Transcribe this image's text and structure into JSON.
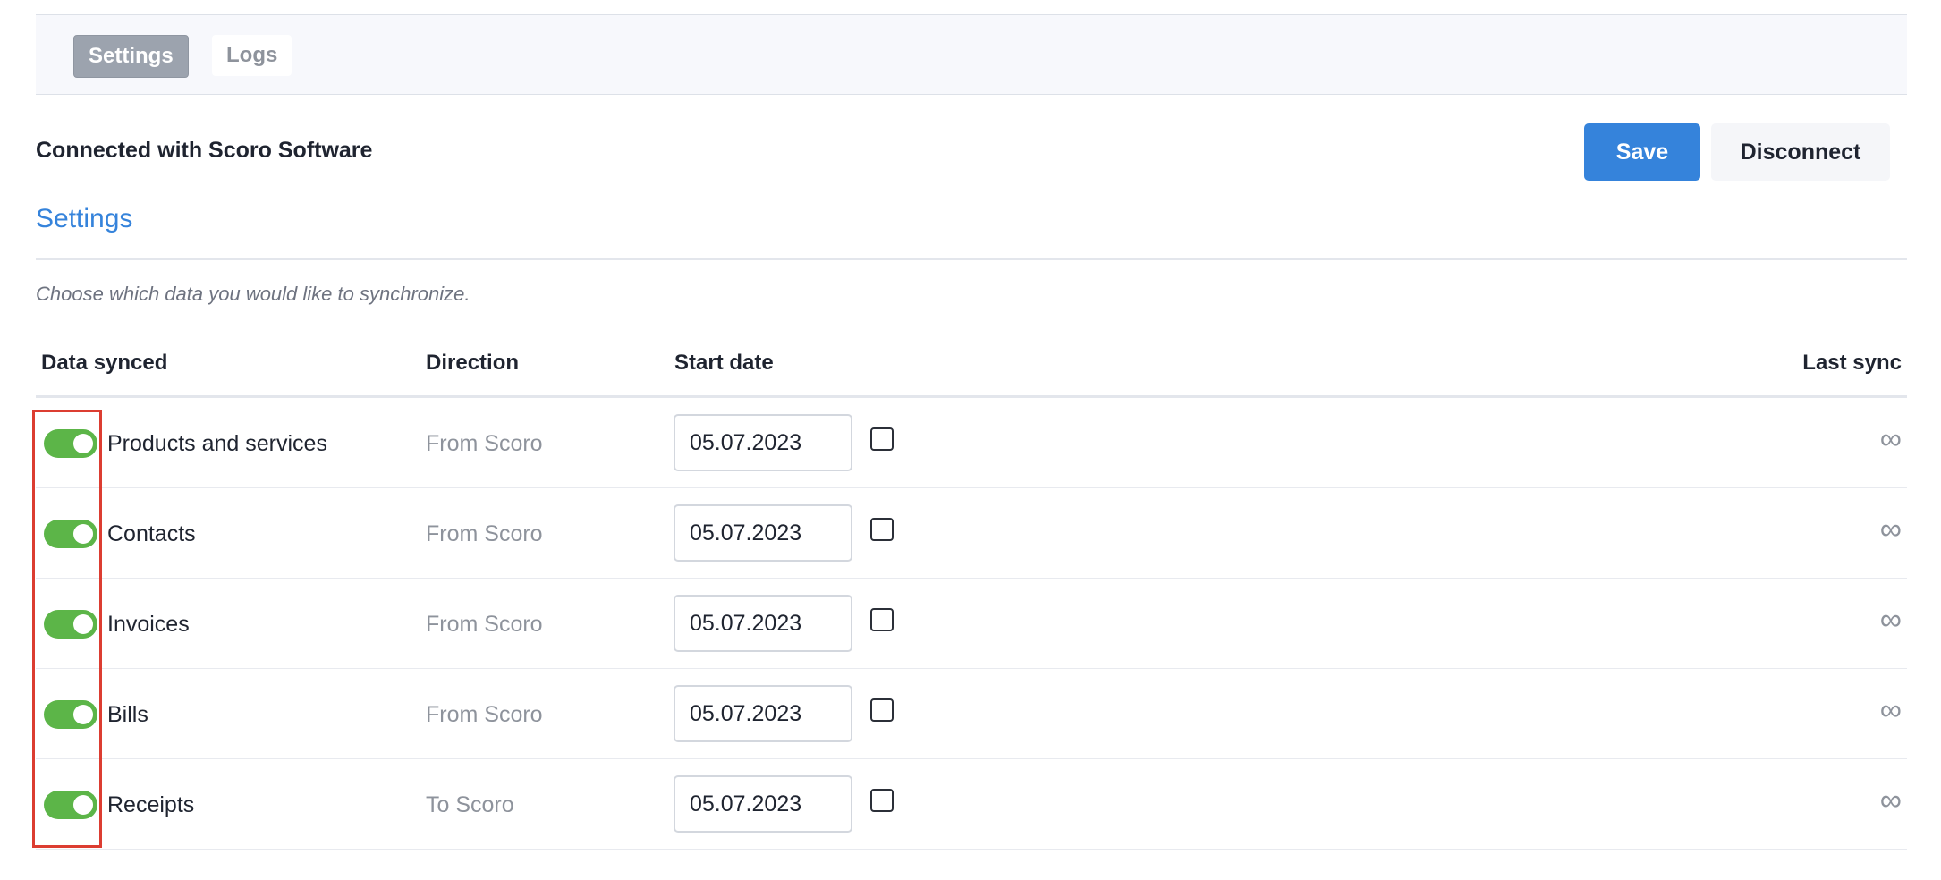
{
  "tabs": [
    {
      "label": "Settings",
      "active": true
    },
    {
      "label": "Logs",
      "active": false
    }
  ],
  "header": {
    "connected_label": "Connected with Scoro Software",
    "save_label": "Save",
    "disconnect_label": "Disconnect"
  },
  "settings": {
    "title": "Settings",
    "help_text": "Choose which data you would like to synchronize."
  },
  "table": {
    "columns": {
      "data_synced": "Data synced",
      "direction": "Direction",
      "start_date": "Start date",
      "last_sync": "Last sync"
    },
    "rows": [
      {
        "name": "Products and services",
        "direction": "From Scoro",
        "start_date": "05.07.2023",
        "enabled": true,
        "checked": false,
        "last_sync": "∞"
      },
      {
        "name": "Contacts",
        "direction": "From Scoro",
        "start_date": "05.07.2023",
        "enabled": true,
        "checked": false,
        "last_sync": "∞"
      },
      {
        "name": "Invoices",
        "direction": "From Scoro",
        "start_date": "05.07.2023",
        "enabled": true,
        "checked": false,
        "last_sync": "∞"
      },
      {
        "name": "Bills",
        "direction": "From Scoro",
        "start_date": "05.07.2023",
        "enabled": true,
        "checked": false,
        "last_sync": "∞"
      },
      {
        "name": "Receipts",
        "direction": "To Scoro",
        "start_date": "05.07.2023",
        "enabled": true,
        "checked": false,
        "last_sync": "∞"
      }
    ]
  },
  "colors": {
    "accent": "#3583db",
    "toggle_on": "#5cb548",
    "highlight": "#dc3d31"
  }
}
